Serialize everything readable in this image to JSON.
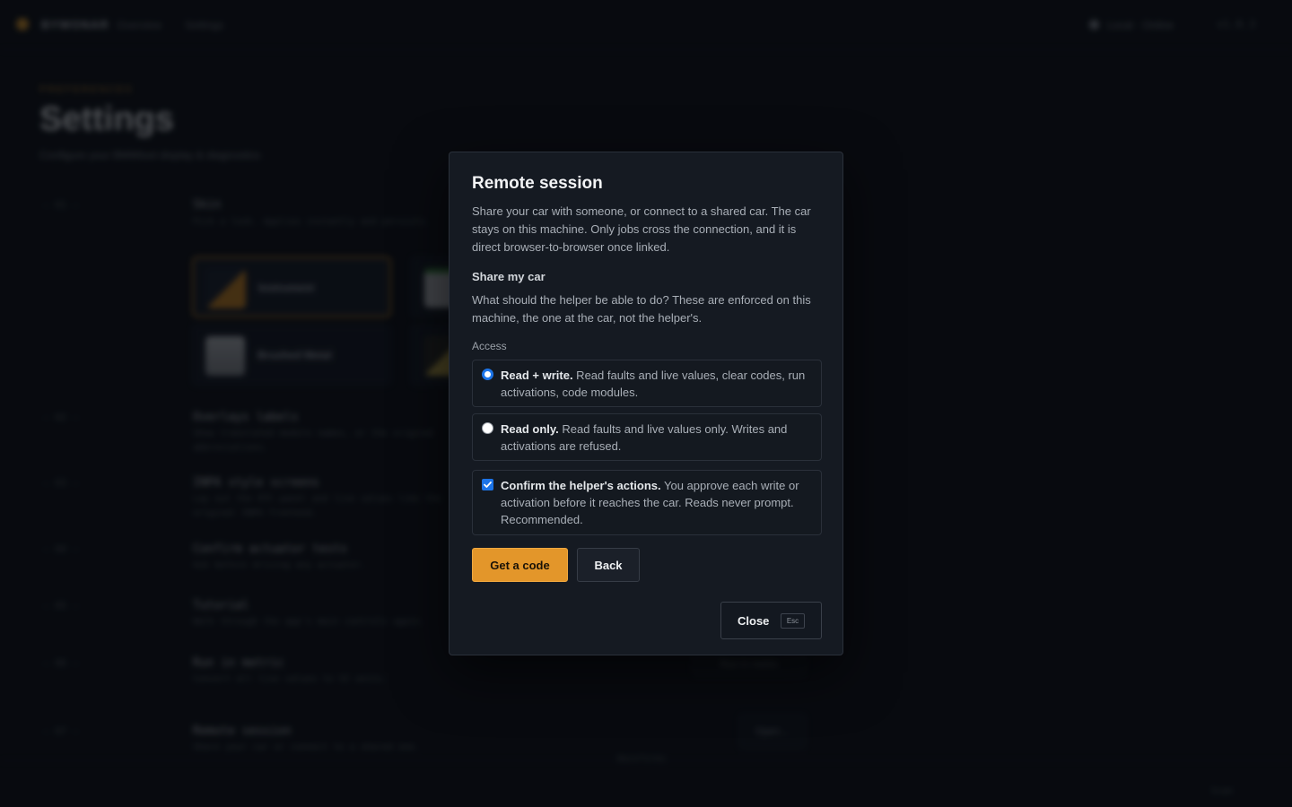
{
  "background": {
    "brand": "BYWONAR",
    "crumbs": [
      "Overview",
      "Settings"
    ],
    "status": "Local · Online",
    "version": "v1.0.3",
    "eyebrow": "PREFERENCES",
    "title": "Settings",
    "subtitle": "Configure your BMWtool display & diagnostics",
    "rows": [
      {
        "num": "— 01 —",
        "title": "Skin",
        "desc": "Pick a look. Applies instantly and persists."
      },
      {
        "num": "— 02 —",
        "title": "Overlays labels",
        "desc": "Show translated module names, or the original abbreviations."
      },
      {
        "num": "— 03 —",
        "title": "INPA style screens",
        "desc": "Lay out the DTC panel and live values like the original INPA frontend."
      },
      {
        "num": "— 04 —",
        "title": "Confirm actuator tests",
        "desc": "Ask before driving any actuator."
      },
      {
        "num": "— 05 —",
        "title": "Tutorial",
        "desc": "Walk through the app's main controls again."
      },
      {
        "num": "— 06 —",
        "title": "Run in metric",
        "desc": "Convert all live values to SI units."
      },
      {
        "num": "— 07 —",
        "title": "Remote session",
        "desc": "Share your car or connect to a shared one."
      }
    ],
    "themes": [
      "Instrument",
      "Brushed Metal"
    ],
    "row_buttons": [
      "Run in metric",
      "Open…"
    ],
    "footer_label": "Waveforms",
    "footer_right": "Scan"
  },
  "modal": {
    "title": "Remote session",
    "intro": "Share your car with someone, or connect to a shared car. The car stays on this machine. Only jobs cross the connection, and it is direct browser-to-browser once linked.",
    "section_title": "Share my car",
    "section_desc": "What should the helper be able to do? These are enforced on this machine, the one at the car, not the helper's.",
    "access_label": "Access",
    "options": [
      {
        "bold": "Read + write.",
        "text": " Read faults and live values, clear codes, run activations, code modules.",
        "checked": true
      },
      {
        "bold": "Read only.",
        "text": " Read faults and live values only. Writes and activations are refused.",
        "checked": false
      }
    ],
    "confirm": {
      "bold": "Confirm the helper's actions.",
      "text": " You approve each write or activation before it reaches the car. Reads never prompt. Recommended.",
      "checked": true
    },
    "primary_button": "Get a code",
    "secondary_button": "Back",
    "close_button": "Close",
    "close_shortcut": "Esc",
    "accent_color": "#e3962a",
    "control_color": "#1c74e8"
  }
}
